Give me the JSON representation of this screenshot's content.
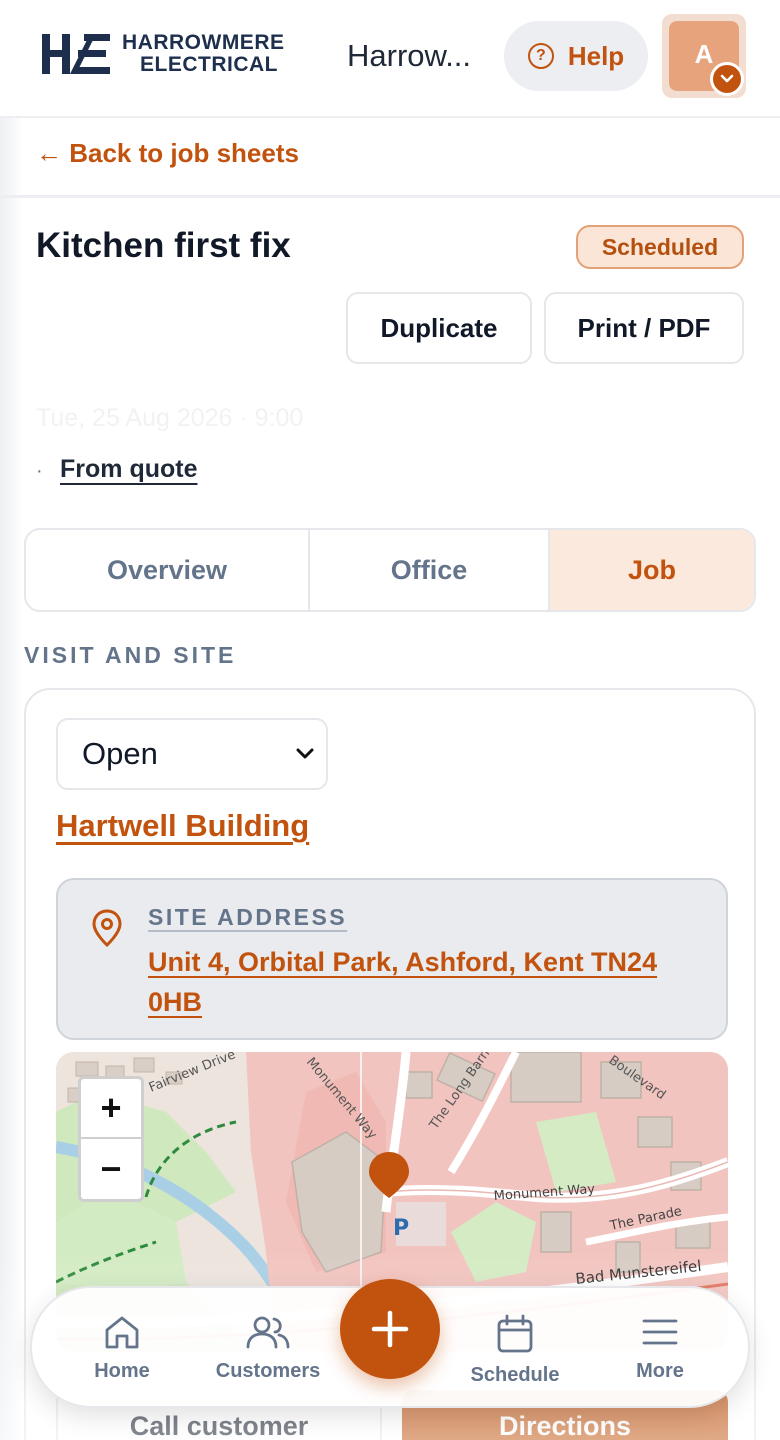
{
  "header": {
    "logo_line1": "HARROWMERE",
    "logo_line2": "ELECTRICAL",
    "app_name": "Harrow...",
    "help_label": "Help",
    "avatar_initial": "A"
  },
  "nav_back": {
    "label": "← Back to job sheets"
  },
  "job": {
    "title": "Kitchen first fix",
    "status": "Scheduled",
    "duplicate_label": "Duplicate",
    "print_label": "Print / PDF",
    "date_time": "Tue, 25 Aug 2026 · 9:00",
    "bullet": "·",
    "from_quote_label": "From quote"
  },
  "tabs": [
    {
      "label": "Overview"
    },
    {
      "label": "Office"
    },
    {
      "label": "Job"
    }
  ],
  "active_tab": "Job",
  "section": {
    "heading": "VISIT AND SITE",
    "status_select_value": "Open",
    "site_name": "Hartwell Building",
    "address_label": "SITE ADDRESS",
    "address_value": "Unit 4, Orbital Park, Ashford, Kent TN24 0HB"
  },
  "map": {
    "zoom_in": "+",
    "zoom_out": "−",
    "labels": {
      "fairview": "Fairview Drive",
      "monument_way_v": "Monument Way",
      "long_barn": "The Long Barn",
      "boulevard": "Boulevard",
      "monument_way_h": "Monument Way",
      "the_parade": "The Parade",
      "bad_munstereifel": "Bad Munstereifel",
      "parking": "P"
    }
  },
  "actions": {
    "call_label": "Call customer",
    "directions_label": "Directions"
  },
  "bottom_nav": {
    "home": "Home",
    "customers": "Customers",
    "schedule": "Schedule",
    "more": "More"
  },
  "colors": {
    "accent": "#c2530e",
    "navy": "#1e2f4e",
    "muted": "#64748b"
  }
}
